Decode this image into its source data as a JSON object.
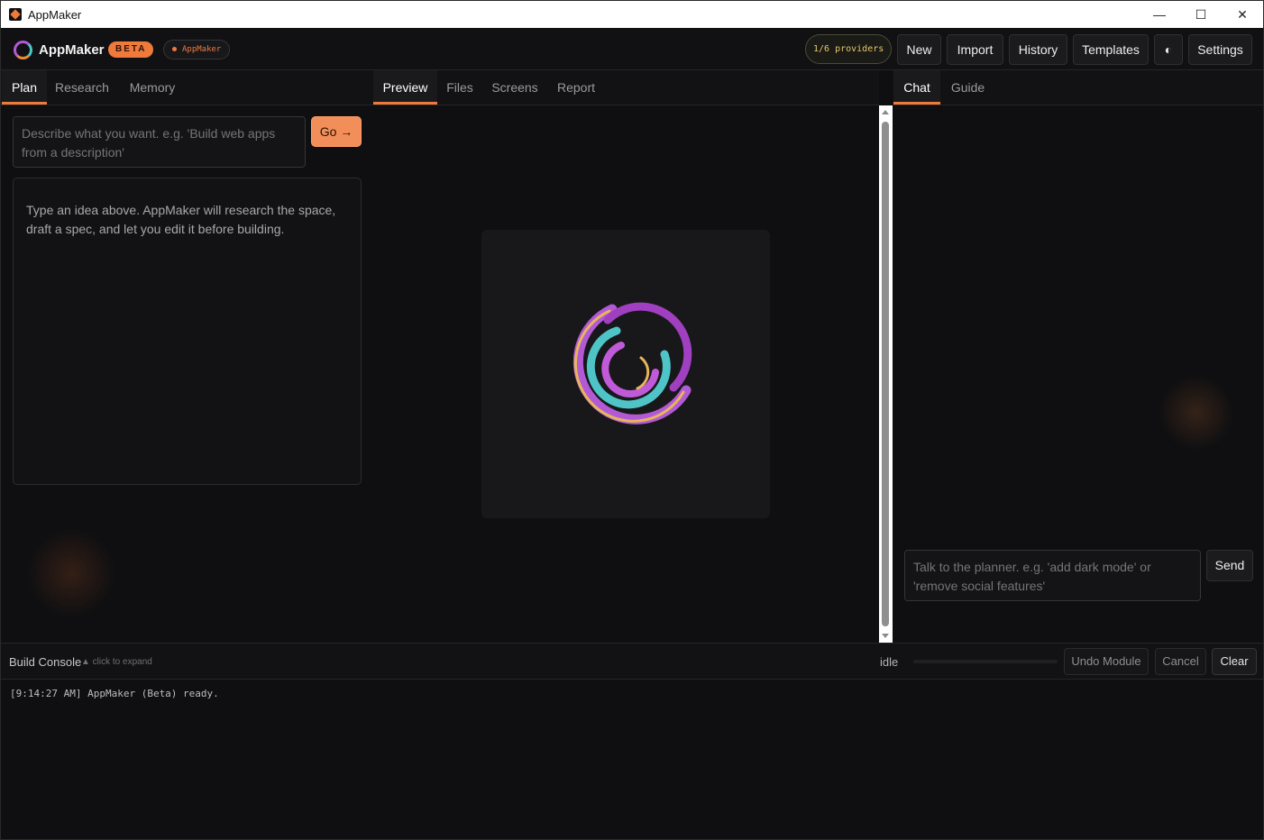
{
  "window": {
    "title": "AppMaker",
    "controls": [
      "—",
      "☐",
      "✕"
    ]
  },
  "header": {
    "brand": "AppMaker",
    "badge": "BETA",
    "project_pill": "AppMaker",
    "providers": "1/6 providers",
    "buttons": {
      "new": "New",
      "import": "Import",
      "history": "History",
      "templates": "Templates",
      "theme": "◐",
      "settings": "Settings"
    }
  },
  "left": {
    "tabs": [
      "Plan",
      "Research",
      "Memory"
    ],
    "active_tab": "Plan",
    "idea_placeholder": "Describe what you want. e.g. 'Build web apps from a description'",
    "go_label": "Go →",
    "plan_text": "Type an idea above. AppMaker will research the space, draft a spec, and let you edit it before building."
  },
  "center": {
    "tabs": [
      "Preview",
      "Files",
      "Screens",
      "Report"
    ],
    "active_tab": "Preview"
  },
  "right": {
    "tabs": [
      "Chat",
      "Guide"
    ],
    "active_tab": "Chat",
    "chat_placeholder": "Talk to the planner. e.g. 'add dark mode' or 'remove social features'",
    "send_label": "Send"
  },
  "console": {
    "title": "Build Console",
    "hint": "▲ click to expand",
    "status": "idle",
    "progress": 0,
    "buttons": {
      "undo": "Undo Module",
      "cancel": "Cancel",
      "clear": "Clear"
    },
    "log": "[9:14:27 AM] AppMaker (Beta) ready."
  },
  "colors": {
    "accent": "#f07a3c",
    "background": "#0f0f11",
    "panel": "#121214",
    "logo_purple": "#b25ad6",
    "logo_teal": "#4fc4c7",
    "logo_gold": "#e8b55a"
  }
}
